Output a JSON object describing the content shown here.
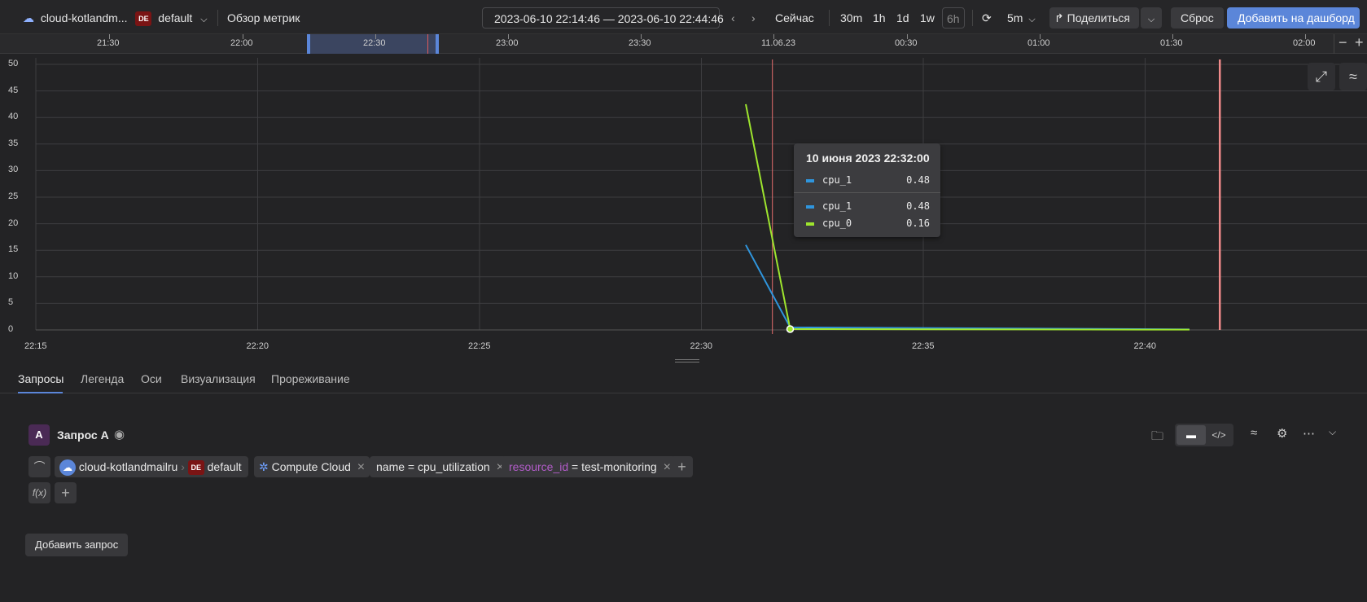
{
  "header": {
    "cloud_name": "cloud-kotlandm...",
    "folder_badge": "DE",
    "folder_name": "default",
    "page_title": "Обзор метрик",
    "time_range": "2023-06-10 22:14:46 — 2023-06-10 22:44:46",
    "now_label": "Сейчас",
    "quick_ranges": [
      "30m",
      "1h",
      "1d",
      "1w",
      "6h"
    ],
    "refresh_interval": "5m",
    "share_label": "Поделиться",
    "reset_label": "Сброс",
    "add_dashboard_label": "Добавить на дашборд"
  },
  "ruler": {
    "ticks": [
      "21:30",
      "22:00",
      "22:30",
      "23:00",
      "23:30",
      "11.06.23",
      "00:30",
      "01:00",
      "01:30",
      "02:00"
    ]
  },
  "chart_data": {
    "type": "line",
    "y_ticks": [
      "50",
      "45",
      "40",
      "35",
      "30",
      "25",
      "20",
      "15",
      "10",
      "5",
      "0"
    ],
    "x_ticks": [
      "22:15",
      "22:20",
      "22:25",
      "22:30",
      "22:35",
      "22:40"
    ],
    "ylim": [
      0,
      50
    ],
    "grid": true,
    "series": [
      {
        "name": "cpu_1",
        "color": "#2f95dd",
        "points": [
          [
            "22:31:00",
            16
          ],
          [
            "22:32:00",
            0.48
          ],
          [
            "22:41:00",
            0.1
          ]
        ]
      },
      {
        "name": "cpu_0",
        "color": "#9ee52e",
        "points": [
          [
            "22:31:00",
            42.5
          ],
          [
            "22:32:00",
            0.16
          ],
          [
            "22:41:00",
            0.05
          ]
        ]
      }
    ],
    "tooltip": {
      "title": "10 июня 2023 22:32:00",
      "pinned": {
        "name": "cpu_1",
        "value": "0.48",
        "color": "#2f95dd"
      },
      "rows": [
        {
          "name": "cpu_1",
          "value": "0.48",
          "color": "#2f95dd"
        },
        {
          "name": "cpu_0",
          "value": "0.16",
          "color": "#9ee52e"
        }
      ]
    }
  },
  "tabs": [
    "Запросы",
    "Легенда",
    "Оси",
    "Визуализация",
    "Прореживание"
  ],
  "query": {
    "letter": "A",
    "title": "Запрос A",
    "cloud": "cloud-kotlandmailru",
    "folder_badge": "DE",
    "folder": "default",
    "service": "Compute Cloud",
    "filter_name": "name = cpu_utilization",
    "filter_resource_key": "resource_id",
    "filter_resource_value": " = test-monitoring",
    "func_label": "f(x)"
  },
  "add_query_label": "Добавить запрос"
}
